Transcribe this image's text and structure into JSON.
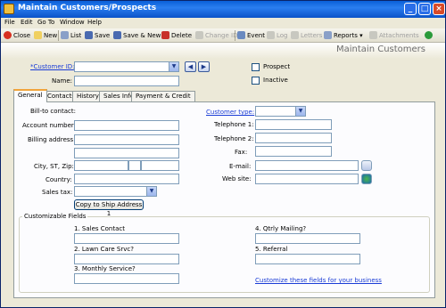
{
  "window": {
    "title": "Maintain Customers/Prospects"
  },
  "menu": {
    "file": "File",
    "edit": "Edit",
    "goto": "Go To",
    "window": "Window",
    "help": "Help"
  },
  "toolbar": {
    "close": "Close",
    "new": "New",
    "list": "List",
    "save": "Save",
    "save_new": "Save & New",
    "delete": "Delete",
    "change_id": "Change ID",
    "event": "Event",
    "log": "Log",
    "letters": "Letters",
    "reports": "Reports",
    "attachments": "Attachments"
  },
  "heading": "Maintain Customers",
  "customer": {
    "id_label": "*Customer ID:",
    "id_value": "",
    "name_label": "Name:",
    "name_value": "",
    "prospect_label": "Prospect",
    "prospect_checked": false,
    "inactive_label": "Inactive",
    "inactive_checked": false
  },
  "tabs": [
    "General",
    "Contacts",
    "History",
    "Sales Info",
    "Payment & Credit"
  ],
  "general": {
    "bill_to": "Bill-to contact:",
    "account_number": "Account number:",
    "billing_address": "Billing address:",
    "city_st_zip": "City, ST, Zip:",
    "country": "Country:",
    "sales_tax": "Sales tax:",
    "copy_button": "Copy to Ship Address 1",
    "customer_type": "Customer type:",
    "telephone_1": "Telephone 1:",
    "telephone_2": "Telephone 2:",
    "fax": "Fax:",
    "email": "E-mail:",
    "website": "Web site:"
  },
  "custom_fields": {
    "title": "Customizable Fields",
    "f1": "1. Sales Contact",
    "f2": "2. Lawn Care Srvc?",
    "f3": "3. Monthly Service?",
    "f4": "4. Qtrly Mailing?",
    "f5": "5. Referral",
    "customize_link": "Customize these fields for your business"
  }
}
